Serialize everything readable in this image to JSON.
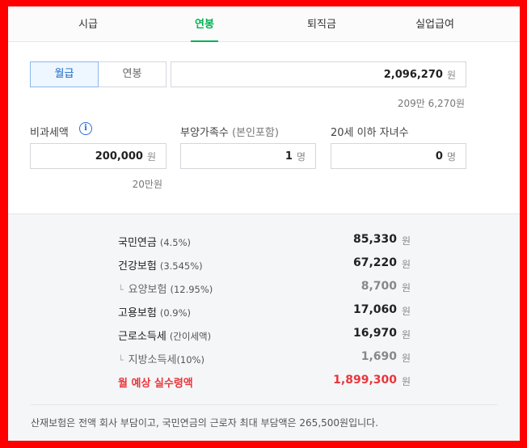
{
  "tabs": [
    "시급",
    "연봉",
    "퇴직금",
    "실업급여"
  ],
  "active_tab": "연봉",
  "salary_type": {
    "monthly": "월급",
    "annual": "연봉",
    "selected": "월급"
  },
  "salary_input": {
    "value": "2,096,270",
    "unit": "원",
    "hint": "209만 6,270원"
  },
  "nontax": {
    "label": "비과세액",
    "value": "200,000",
    "unit": "원",
    "hint": "20만원"
  },
  "dependents": {
    "label": "부양가족수",
    "label_sub": "(본인포함)",
    "value": "1",
    "unit": "명"
  },
  "children": {
    "label": "20세 이하 자녀수",
    "value": "0",
    "unit": "명"
  },
  "deductions": [
    {
      "name": "국민연금",
      "rate": "(4.5%)",
      "amount": "85,330",
      "unit": "원",
      "sub": false
    },
    {
      "name": "건강보험",
      "rate": "(3.545%)",
      "amount": "67,220",
      "unit": "원",
      "sub": false
    },
    {
      "name": "요양보험",
      "rate": "(12.95%)",
      "amount": "8,700",
      "unit": "원",
      "sub": true
    },
    {
      "name": "고용보험",
      "rate": "(0.9%)",
      "amount": "17,060",
      "unit": "원",
      "sub": false
    },
    {
      "name": "근로소득세",
      "rate": "(간이세액)",
      "amount": "16,970",
      "unit": "원",
      "sub": false
    },
    {
      "name": "지방소득세",
      "rate": "(10%)",
      "amount": "1,690",
      "unit": "원",
      "sub": true
    }
  ],
  "total": {
    "name": "월 예상 실수령액",
    "amount": "1,899,300",
    "unit": "원"
  },
  "note": "산재보험은 전액 회사 부담이고, 국민연금의 근로자 최대 부담액은 265,500원입니다.",
  "colors": {
    "accent_green": "#03b252",
    "accent_blue": "#1668c4",
    "total_red": "#e8363b"
  },
  "icons": {
    "info": "info-circle-icon"
  }
}
